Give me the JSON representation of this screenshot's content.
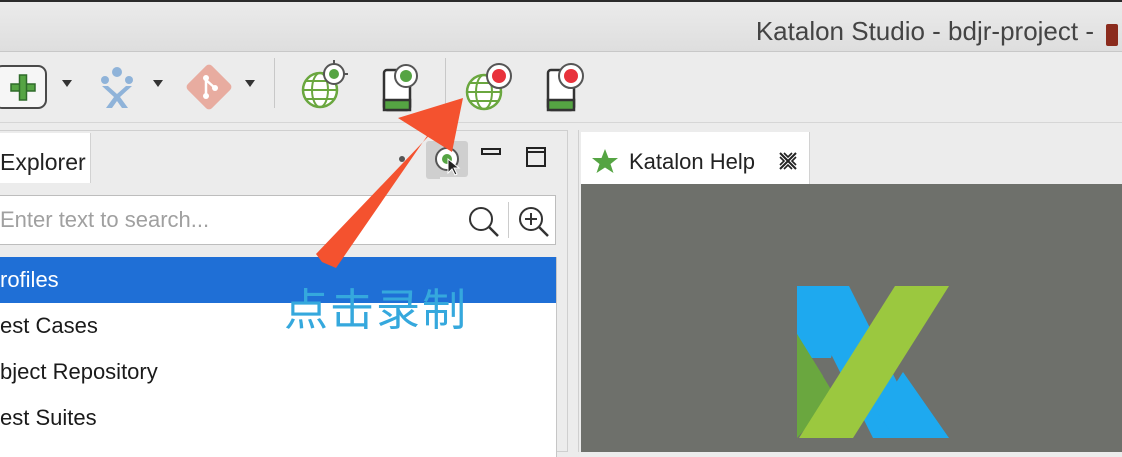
{
  "window": {
    "title": "Katalon Studio - bdjr-project -"
  },
  "toolbar": {
    "items": [
      {
        "name": "new-button",
        "icon": "plus-icon"
      },
      {
        "name": "new-dropdown",
        "icon": "chevron-down-icon"
      },
      {
        "name": "jira-button",
        "icon": "jira-icon"
      },
      {
        "name": "jira-dropdown",
        "icon": "chevron-down-icon"
      },
      {
        "name": "git-button",
        "icon": "git-icon"
      },
      {
        "name": "git-dropdown",
        "icon": "chevron-down-icon"
      },
      {
        "name": "spy-web-button",
        "icon": "globe-target-icon"
      },
      {
        "name": "spy-mobile-button",
        "icon": "mobile-target-icon"
      },
      {
        "name": "record-web-button",
        "icon": "globe-record-icon"
      },
      {
        "name": "record-mobile-button",
        "icon": "mobile-record-icon"
      }
    ]
  },
  "explorer": {
    "tab_label": "Explorer",
    "search_placeholder": "Enter text to search...",
    "items": [
      {
        "label": "rofiles",
        "selected": true
      },
      {
        "label": "est Cases",
        "selected": false
      },
      {
        "label": "bject Repository",
        "selected": false
      },
      {
        "label": "est Suites",
        "selected": false
      }
    ]
  },
  "help": {
    "tab_label": "Katalon Help"
  },
  "annotation": {
    "text": "点击录制",
    "color": "#35a8dd",
    "arrow_color": "#f4522f"
  },
  "colors": {
    "selection": "#1f6fd6",
    "help_bg": "#6e706b",
    "logo_blue": "#1ea9ef",
    "logo_green": "#9bc83f",
    "logo_dark_green": "#6aa73f"
  }
}
